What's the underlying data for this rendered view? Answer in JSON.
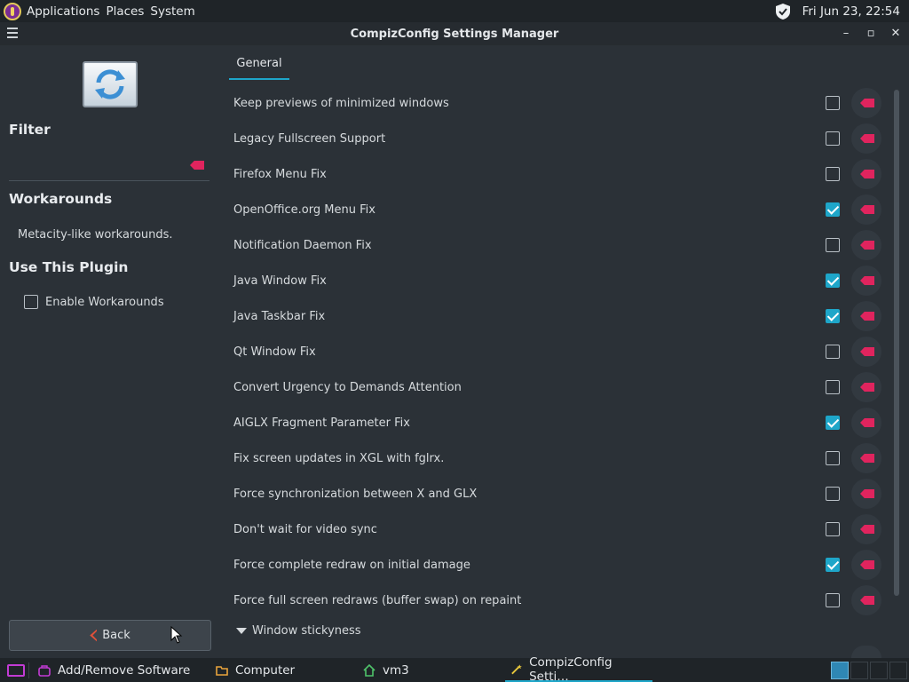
{
  "top_panel": {
    "menus": [
      "Applications",
      "Places",
      "System"
    ],
    "clock": "Fri Jun 23, 22:54"
  },
  "window": {
    "title": "CompizConfig Settings Manager"
  },
  "left": {
    "filter_title": "Filter",
    "filter_value": "",
    "plugin_title": "Workarounds",
    "plugin_desc": "Metacity-like workarounds.",
    "use_title": "Use This Plugin",
    "enable_label": "Enable Workarounds",
    "enable_checked": false,
    "back_label": "Back"
  },
  "tabs": [
    {
      "label": "General"
    }
  ],
  "settings": [
    {
      "label": "Keep previews of minimized windows",
      "checked": false
    },
    {
      "label": "Legacy Fullscreen Support",
      "checked": false
    },
    {
      "label": "Firefox Menu Fix",
      "checked": false
    },
    {
      "label": "OpenOffice.org Menu Fix",
      "checked": true
    },
    {
      "label": "Notification Daemon Fix",
      "checked": false
    },
    {
      "label": "Java Window Fix",
      "checked": true
    },
    {
      "label": "Java Taskbar Fix",
      "checked": true
    },
    {
      "label": "Qt Window Fix",
      "checked": false
    },
    {
      "label": "Convert Urgency to Demands Attention",
      "checked": false
    },
    {
      "label": "AIGLX Fragment Parameter Fix",
      "checked": true
    },
    {
      "label": "Fix screen updates in XGL with fglrx.",
      "checked": false
    },
    {
      "label": "Force synchronization between X and GLX",
      "checked": false
    },
    {
      "label": "Don't wait for video sync",
      "checked": false
    },
    {
      "label": "Force complete redraw on initial damage",
      "checked": true
    },
    {
      "label": "Force full screen redraws (buffer swap) on repaint",
      "checked": false
    }
  ],
  "expander_label": "Window stickyness",
  "taskbar": {
    "tasks": [
      {
        "label": "Add/Remove Software",
        "icon": "bag-icon"
      },
      {
        "label": "Computer",
        "icon": "folder-icon"
      },
      {
        "label": "vm3",
        "icon": "home-icon"
      },
      {
        "label": "CompizConfig Setti…",
        "icon": "wand-icon"
      }
    ]
  },
  "colors": {
    "accent": "#1ea6c9",
    "reset": "#e0245e",
    "background": "#2b3137"
  }
}
